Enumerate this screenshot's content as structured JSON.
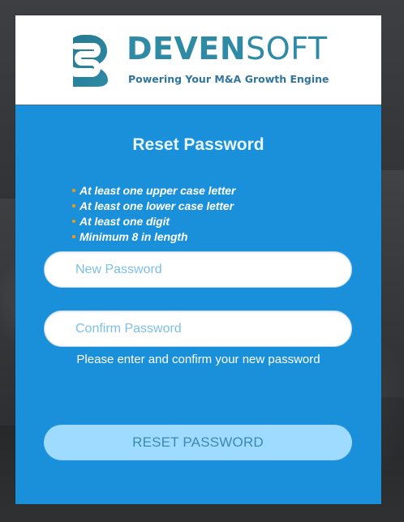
{
  "brand": {
    "logo_prefix": "DEVEN",
    "logo_suffix": "SOFT",
    "tagline": "Powering Your M&A Growth Engine",
    "logo_icon": "devensoft-s-logo-icon",
    "logo_color_primary": "#2f8aa5",
    "logo_color_dark": "#31749d"
  },
  "form": {
    "title": "Reset Password",
    "requirements": [
      "At least one upper case letter",
      "At least one lower case letter",
      "At least one digit",
      "Minimum 8 in length"
    ],
    "new_password": {
      "value": "",
      "placeholder": "New Password"
    },
    "confirm_password": {
      "value": "",
      "placeholder": "Confirm Password"
    },
    "helper_text": "Please enter and confirm your new password",
    "submit_label": "RESET PASSWORD"
  },
  "colors": {
    "panel_blue": "#1a8fda",
    "button_light_blue": "#9fdbff",
    "bullet_orange": "#ff9800"
  }
}
